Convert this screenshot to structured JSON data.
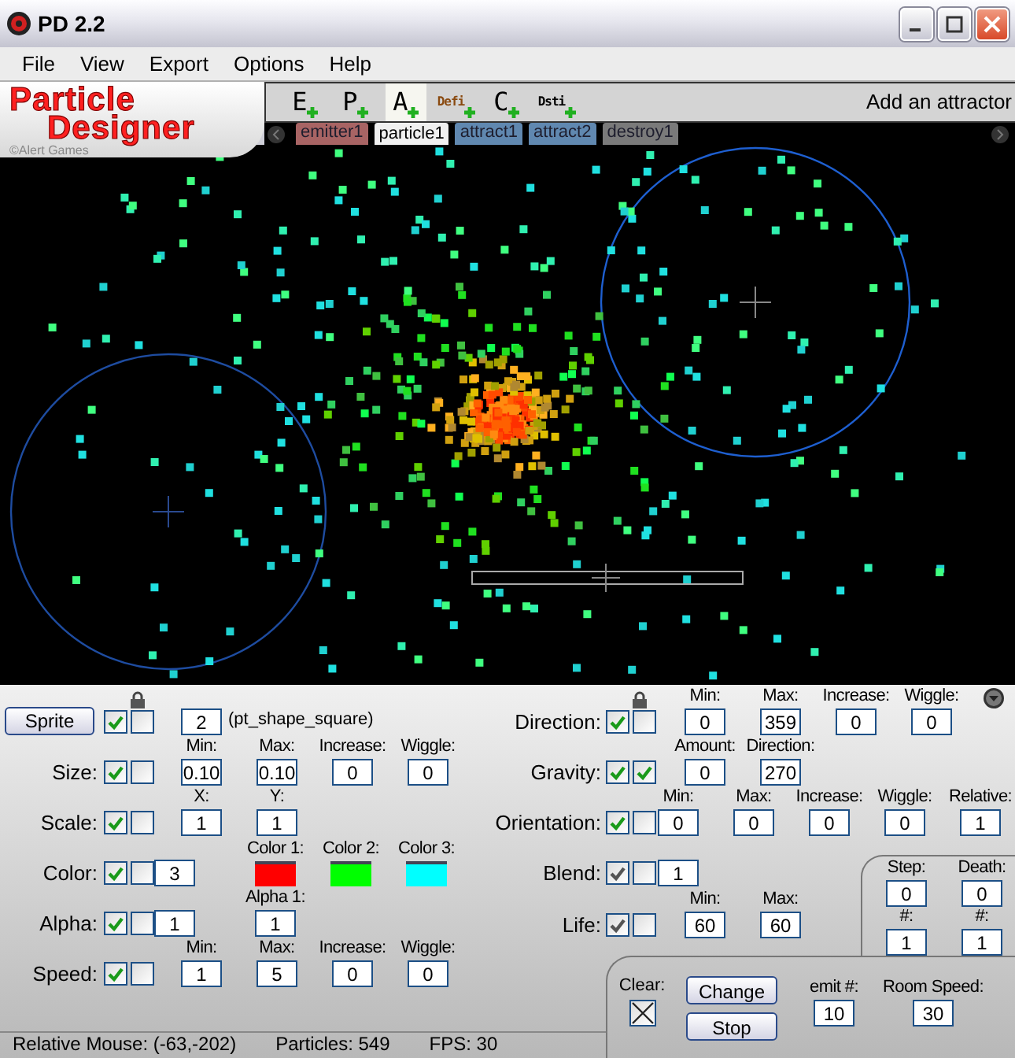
{
  "window": {
    "title": "PD 2.2"
  },
  "menu": [
    {
      "label": "File"
    },
    {
      "label": "View"
    },
    {
      "label": "Export"
    },
    {
      "label": "Options"
    },
    {
      "label": "Help"
    }
  ],
  "logo": {
    "line_1": "Particle",
    "line_2": "Designer",
    "credit": "©Alert Games"
  },
  "tools": [
    {
      "label": "E",
      "kind": "large",
      "color": "#000000",
      "selected": false
    },
    {
      "label": "P",
      "kind": "large",
      "color": "#000000",
      "selected": false
    },
    {
      "label": "A",
      "kind": "large",
      "color": "#000000",
      "selected": true
    },
    {
      "label": "Defi",
      "kind": "small",
      "color": "#8a4a10",
      "selected": false
    },
    {
      "label": "C",
      "kind": "large",
      "color": "#000000",
      "selected": false
    },
    {
      "label": "Dsti",
      "kind": "small",
      "color": "#000000",
      "selected": false
    }
  ],
  "toolbar_hint": "Add an attractor",
  "object_tabs": [
    {
      "label": "emitter1",
      "color": "#a86464",
      "selected": false
    },
    {
      "label": "particle1",
      "color": "#f0f0f0",
      "selected": true
    },
    {
      "label": "attract1",
      "color": "#6088b0",
      "selected": false
    },
    {
      "label": "attract2",
      "color": "#6088b0",
      "selected": false
    },
    {
      "label": "destroy1",
      "color": "#7a7a7a",
      "selected": false
    }
  ],
  "sprite": {
    "button": "Sprite",
    "checks": [
      true,
      false
    ],
    "value": "2",
    "shape": "(pt_shape_square)"
  },
  "left_rows": [
    {
      "label": "Size:",
      "dim": false,
      "checks": [
        true,
        false
      ],
      "fields": [
        {
          "header": "Min:",
          "kind": "input",
          "value": "0.10"
        },
        {
          "header": "Max:",
          "kind": "input",
          "value": "0.10"
        },
        {
          "header": "Increase:",
          "kind": "input",
          "value": "0"
        },
        {
          "header": "Wiggle:",
          "kind": "input",
          "value": "0"
        }
      ]
    },
    {
      "label": "Scale:",
      "dim": false,
      "checks": [
        true,
        false
      ],
      "fields": [
        {
          "header": "X:",
          "kind": "input",
          "value": "1"
        },
        {
          "header": "Y:",
          "kind": "input",
          "value": "1"
        }
      ]
    },
    {
      "label": "Color:",
      "dim": false,
      "checks": [
        true,
        false
      ],
      "lead": "3",
      "fields": [
        {
          "header": "Color 1:",
          "kind": "swatch",
          "color": "#ff0000"
        },
        {
          "header": "Color 2:",
          "kind": "swatch",
          "color": "#00ff00"
        },
        {
          "header": "Color 3:",
          "kind": "swatch",
          "color": "#00ffff"
        }
      ]
    },
    {
      "label": "Alpha:",
      "dim": false,
      "checks": [
        true,
        false
      ],
      "lead": "1",
      "fields": [
        {
          "header": "Alpha 1:",
          "kind": "input",
          "value": "1"
        }
      ]
    },
    {
      "label": "Speed:",
      "dim": false,
      "checks": [
        true,
        false
      ],
      "fields": [
        {
          "header": "Min:",
          "kind": "input",
          "value": "1"
        },
        {
          "header": "Max:",
          "kind": "input",
          "value": "5"
        },
        {
          "header": "Increase:",
          "kind": "input",
          "value": "0"
        },
        {
          "header": "Wiggle:",
          "kind": "input",
          "value": "0"
        }
      ]
    }
  ],
  "right_rows": [
    {
      "label": "Direction:",
      "dim": false,
      "checks": [
        true,
        false
      ],
      "fields": [
        {
          "header": "Min:",
          "kind": "input",
          "value": "0"
        },
        {
          "header": "Max:",
          "kind": "input",
          "value": "359"
        },
        {
          "header": "Increase:",
          "kind": "input",
          "value": "0"
        },
        {
          "header": "Wiggle:",
          "kind": "input",
          "value": "0"
        }
      ]
    },
    {
      "label": "Gravity:",
      "dim": false,
      "checks": [
        true,
        true
      ],
      "fields": [
        {
          "header": "Amount:",
          "kind": "input",
          "value": "0"
        },
        {
          "header": "Direction:",
          "kind": "input",
          "value": "270"
        }
      ]
    },
    {
      "label": "Orientation:",
      "dim": false,
      "checks": [
        true,
        false
      ],
      "fields": [
        {
          "header": "Min:",
          "kind": "input",
          "value": "0"
        },
        {
          "header": "Max:",
          "kind": "input",
          "value": "0"
        },
        {
          "header": "Increase:",
          "kind": "input",
          "value": "0"
        },
        {
          "header": "Wiggle:",
          "kind": "input",
          "value": "0"
        },
        {
          "header": "Relative:",
          "kind": "input",
          "value": "1"
        }
      ]
    },
    {
      "label": "Blend:",
      "dim": true,
      "checks": [
        true,
        false
      ],
      "lead": "1",
      "fields": []
    },
    {
      "label": "Life:",
      "dim": true,
      "checks": [
        true,
        false
      ],
      "fields": [
        {
          "header": "Min:",
          "kind": "input",
          "value": "60"
        },
        {
          "header": "Max:",
          "kind": "input",
          "value": "60"
        }
      ]
    }
  ],
  "counters": [
    {
      "header": "Step:",
      "value": "0"
    },
    {
      "header": "Death:",
      "value": "0"
    },
    {
      "header": "#:",
      "value": "1"
    },
    {
      "header": "#:",
      "value": "1"
    }
  ],
  "controls": {
    "clear": {
      "label": "Clear:",
      "checked": true
    },
    "buttons": [
      {
        "label": "Change"
      },
      {
        "label": "Stop"
      }
    ],
    "emit": {
      "header": "emit #:",
      "value": "10"
    },
    "room_speed": {
      "header": "Room Speed:",
      "value": "30"
    }
  },
  "status_bar": {
    "mouse": "Relative Mouse: (-63,-202)",
    "particles": "Particles: 549",
    "fps": "FPS: 30"
  }
}
